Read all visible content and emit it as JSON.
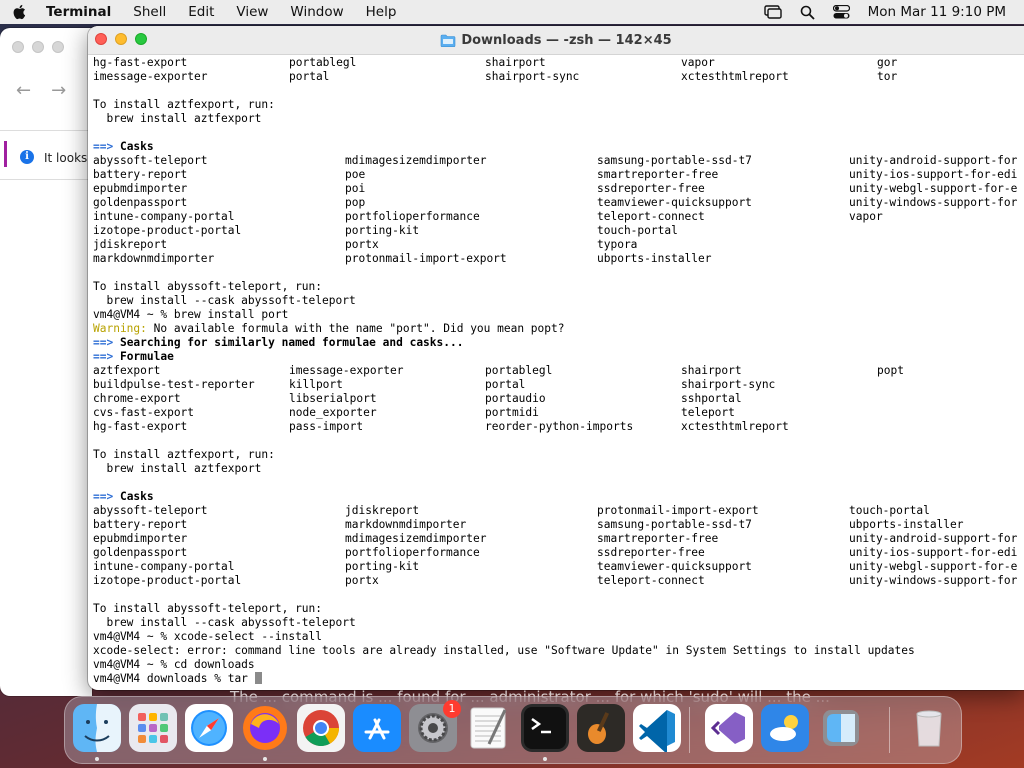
{
  "menubar": {
    "app_name": "Terminal",
    "menus": [
      "Shell",
      "Edit",
      "View",
      "Window",
      "Help"
    ],
    "clock": "Mon Mar 11  9:10 PM"
  },
  "browser": {
    "notice_text": "It looks l"
  },
  "terminal": {
    "title": "Downloads — -zsh — 142×45",
    "lines": [
      {
        "type": "cols",
        "cells": [
          "hg-fast-export",
          "portablegl",
          "shairport",
          "vapor",
          "gor"
        ]
      },
      {
        "type": "cols",
        "cells": [
          "imessage-exporter",
          "portal",
          "shairport-sync",
          "xctesthtmlreport",
          "tor"
        ]
      },
      {
        "type": "text",
        "text": ""
      },
      {
        "type": "text",
        "text": "To install aztfexport, run:"
      },
      {
        "type": "text",
        "text": "  brew install aztfexport"
      },
      {
        "type": "text",
        "text": ""
      },
      {
        "type": "header",
        "text": "Casks"
      },
      {
        "type": "cols4",
        "cells": [
          "abyssoft-teleport",
          "mdimagesizemdimporter",
          "samsung-portable-ssd-t7",
          "unity-android-support-for"
        ]
      },
      {
        "type": "cols4",
        "cells": [
          "battery-report",
          "poe",
          "smartreporter-free",
          "unity-ios-support-for-edi"
        ]
      },
      {
        "type": "cols4",
        "cells": [
          "epubmdimporter",
          "poi",
          "ssdreporter-free",
          "unity-webgl-support-for-e"
        ]
      },
      {
        "type": "cols4",
        "cells": [
          "goldenpassport",
          "pop",
          "teamviewer-quicksupport",
          "unity-windows-support-for"
        ]
      },
      {
        "type": "cols4",
        "cells": [
          "intune-company-portal",
          "portfolioperformance",
          "teleport-connect",
          "vapor"
        ]
      },
      {
        "type": "cols4",
        "cells": [
          "izotope-product-portal",
          "porting-kit",
          "touch-portal",
          ""
        ]
      },
      {
        "type": "cols4",
        "cells": [
          "jdiskreport",
          "portx",
          "typora",
          ""
        ]
      },
      {
        "type": "cols4",
        "cells": [
          "markdownmdimporter",
          "protonmail-import-export",
          "ubports-installer",
          ""
        ]
      },
      {
        "type": "text",
        "text": ""
      },
      {
        "type": "text",
        "text": "To install abyssoft-teleport, run:"
      },
      {
        "type": "text",
        "text": "  brew install --cask abyssoft-teleport"
      },
      {
        "type": "text",
        "text": "vm4@VM4 ~ % brew install port"
      },
      {
        "type": "warning",
        "label": "Warning:",
        "text": " No available formula with the name \"port\". Did you mean popt?"
      },
      {
        "type": "header",
        "text": "Searching for similarly named formulae and casks..."
      },
      {
        "type": "header",
        "text": "Formulae"
      },
      {
        "type": "cols",
        "cells": [
          "aztfexport",
          "imessage-exporter",
          "portablegl",
          "shairport",
          "popt"
        ]
      },
      {
        "type": "cols",
        "cells": [
          "buildpulse-test-reporter",
          "killport",
          "portal",
          "shairport-sync",
          ""
        ]
      },
      {
        "type": "cols",
        "cells": [
          "chrome-export",
          "libserialport",
          "portaudio",
          "sshportal",
          ""
        ]
      },
      {
        "type": "cols",
        "cells": [
          "cvs-fast-export",
          "node_exporter",
          "portmidi",
          "teleport",
          ""
        ]
      },
      {
        "type": "cols",
        "cells": [
          "hg-fast-export",
          "pass-import",
          "reorder-python-imports",
          "xctesthtmlreport",
          ""
        ]
      },
      {
        "type": "text",
        "text": ""
      },
      {
        "type": "text",
        "text": "To install aztfexport, run:"
      },
      {
        "type": "text",
        "text": "  brew install aztfexport"
      },
      {
        "type": "text",
        "text": ""
      },
      {
        "type": "header",
        "text": "Casks"
      },
      {
        "type": "cols4",
        "cells": [
          "abyssoft-teleport",
          "jdiskreport",
          "protonmail-import-export",
          "touch-portal"
        ]
      },
      {
        "type": "cols4",
        "cells": [
          "battery-report",
          "markdownmdimporter",
          "samsung-portable-ssd-t7",
          "ubports-installer"
        ]
      },
      {
        "type": "cols4",
        "cells": [
          "epubmdimporter",
          "mdimagesizemdimporter",
          "smartreporter-free",
          "unity-android-support-for"
        ]
      },
      {
        "type": "cols4",
        "cells": [
          "goldenpassport",
          "portfolioperformance",
          "ssdreporter-free",
          "unity-ios-support-for-edi"
        ]
      },
      {
        "type": "cols4",
        "cells": [
          "intune-company-portal",
          "porting-kit",
          "teamviewer-quicksupport",
          "unity-webgl-support-for-e"
        ]
      },
      {
        "type": "cols4",
        "cells": [
          "izotope-product-portal",
          "portx",
          "teleport-connect",
          "unity-windows-support-for"
        ]
      },
      {
        "type": "text",
        "text": ""
      },
      {
        "type": "text",
        "text": "To install abyssoft-teleport, run:"
      },
      {
        "type": "text",
        "text": "  brew install --cask abyssoft-teleport"
      },
      {
        "type": "text",
        "text": "vm4@VM4 ~ % xcode-select --install"
      },
      {
        "type": "text",
        "text": "xcode-select: error: command line tools are already installed, use \"Software Update\" in System Settings to install updates"
      },
      {
        "type": "text",
        "text": "vm4@VM4 ~ % cd downloads"
      },
      {
        "type": "prompt",
        "text": "vm4@VM4 downloads % tar "
      }
    ]
  },
  "dock": {
    "apps": [
      {
        "name": "finder-icon",
        "running": true
      },
      {
        "name": "launchpad-icon",
        "running": false
      },
      {
        "name": "safari-icon",
        "running": false
      },
      {
        "name": "firefox-icon",
        "running": true
      },
      {
        "name": "chrome-icon",
        "running": false
      },
      {
        "name": "app-store-icon",
        "running": false
      },
      {
        "name": "system-settings-icon",
        "running": false,
        "badge": "1"
      },
      {
        "name": "textedit-icon",
        "running": false
      },
      {
        "name": "terminal-icon",
        "running": true
      },
      {
        "name": "garageband-icon",
        "running": false
      },
      {
        "name": "vscode-icon",
        "running": false
      },
      {
        "name": "visual-studio-icon",
        "running": false
      },
      {
        "name": "weather-icon",
        "running": false
      },
      {
        "name": "migration-assistant-icon",
        "running": false
      },
      {
        "name": "trash-icon",
        "running": false
      }
    ]
  },
  "subtitle_text": "The ... command is ... found for ... administrator ... for which 'sudo' will ... the ..."
}
